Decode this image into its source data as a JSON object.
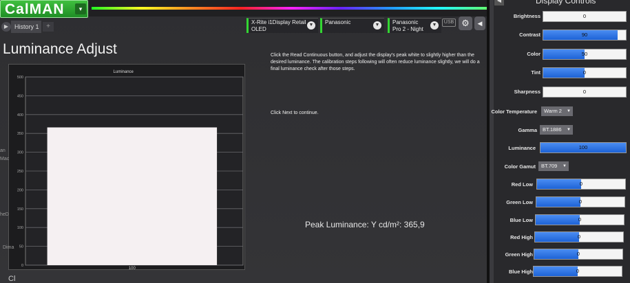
{
  "app": {
    "logo": "CalMAN",
    "logo_caret": "▾"
  },
  "tab": {
    "history_label": "History 1",
    "add_label": "+"
  },
  "devices": {
    "meter_line1": "X-Rite i1Display Retail",
    "meter_line2": "OLED",
    "display_line1": "Panasonic",
    "mode_line1": "Panasonic",
    "mode_line2": "Pro 2 - Night",
    "usb_icon_text": "USB"
  },
  "page": {
    "title": "Luminance Adjust",
    "instructions": "Click the Read Continuous button, and adjust the display's peak white to slightly higher than the desired luminance. The calibration steps following will often reduce luminance slightly, we will do a final luminance check after those steps.",
    "next_hint": "Click Next to continue.",
    "peak_label": "Peak Luminance:",
    "peak_unit": "Y cd/m²:",
    "peak_value": "365,9"
  },
  "chart_data": {
    "type": "bar",
    "title": "Luminance",
    "categories": [
      "100"
    ],
    "values": [
      365.9
    ],
    "ylim": [
      0,
      500
    ],
    "yticks": [
      "0",
      "50",
      "100",
      "150",
      "200",
      "250",
      "300",
      "350",
      "400",
      "450",
      "500"
    ],
    "grid": true,
    "bar_color": "#f5f0f2"
  },
  "panel": {
    "title": "Display Controls",
    "controls": [
      {
        "label": "Brightness",
        "value": "0",
        "fill": 0
      },
      {
        "label": "Contrast",
        "value": "90",
        "fill": 0.9
      },
      {
        "label": "Color",
        "value": "50",
        "fill": 0.5
      },
      {
        "label": "Tint",
        "value": "0",
        "fill": 0.5
      },
      {
        "label": "Sharpness",
        "value": "0",
        "fill": 0
      }
    ],
    "color_temperature": {
      "label": "Color Temperature",
      "value": "Warm 2"
    },
    "gamma": {
      "label": "Gamma",
      "value": "BT.1886"
    },
    "luminance": {
      "label": "Luminance",
      "value": "100",
      "fill": 1
    },
    "color_gamut": {
      "label": "Color Gamut",
      "value": "BT.709"
    },
    "wb_controls": [
      {
        "label": "Red Low",
        "value": "0",
        "fill": 0.5
      },
      {
        "label": "Green Low",
        "value": "0",
        "fill": 0.5
      },
      {
        "label": "Blue Low",
        "value": "0",
        "fill": 0.5
      },
      {
        "label": "Red High",
        "value": "0",
        "fill": 0.5
      },
      {
        "label": "Green High",
        "value": "0",
        "fill": 0.5
      },
      {
        "label": "Blue High",
        "value": "0",
        "fill": 0.5
      }
    ]
  },
  "colors": {
    "accent_green": "#33d633",
    "slider_blue": "#1d62d6"
  },
  "edge": {
    "a": "an",
    "b": "Mac",
    "c": "heD",
    "d": "Dima",
    "e": "Cl"
  }
}
